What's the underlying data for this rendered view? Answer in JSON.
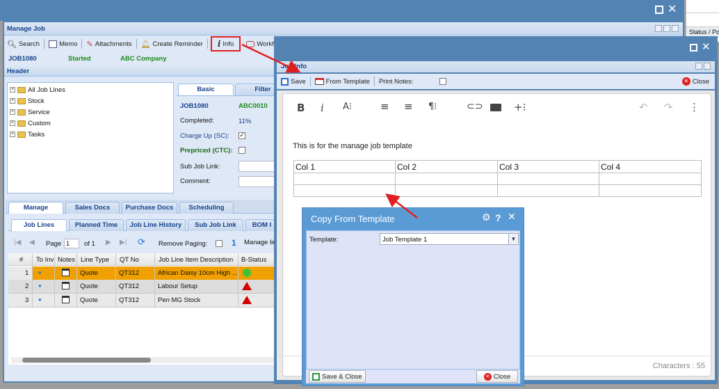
{
  "manage_job": {
    "title": "Manage Job",
    "toolbar": {
      "search": "Search",
      "memo": "Memo",
      "attachments": "Attachments",
      "create_reminder": "Create Reminder",
      "info": "Info",
      "workflow": "Workfl"
    },
    "job_no": "JOB1080",
    "status": "Started",
    "company": "ABC Company",
    "header_label": "Header",
    "status_po_col": "Status / Po",
    "tree": [
      "All Job Lines",
      "Stock",
      "Service",
      "Custom",
      "Tasks"
    ],
    "tabs_top": {
      "basic": "Basic",
      "filter": "Filter"
    },
    "basic": {
      "job": "JOB1080",
      "code": "ABC0010",
      "completed_label": "Completed:",
      "completed_value": "11%",
      "charge_up_label": "Charge Up (SC):",
      "prepriced_label": "Prepriced (CTC):",
      "subjob_label": "Sub Job Link:",
      "comment_label": "Comment:"
    },
    "tabs_main": [
      "Manage",
      "Sales Docs",
      "Purchase Docs",
      "Scheduling"
    ],
    "tabs_sub": [
      "Job Lines",
      "Planned Time",
      "Job Line History",
      "Sub Job Link",
      "BOM I"
    ],
    "pager": {
      "page_label": "Page",
      "page_value": "1",
      "of_label": "of 1",
      "remove_paging": "Remove Paging:",
      "num": "1",
      "manage": "Manage lin"
    },
    "columns": [
      "#",
      "To Inv",
      "Notes",
      "Line Type",
      "QT No",
      "Job Line Item Description",
      "B-Status"
    ],
    "rows": [
      {
        "num": "1",
        "type": "Quote",
        "qt": "QT312",
        "desc": "African Daisy 10cm High ...",
        "status": "green-circle"
      },
      {
        "num": "2",
        "type": "Quote",
        "qt": "QT312",
        "desc": "Labour Setup",
        "status": "red-triangle"
      },
      {
        "num": "3",
        "type": "Quote",
        "qt": "QT312",
        "desc": "Pen MG Stock",
        "status": "red-triangle"
      }
    ]
  },
  "job_info": {
    "title": "Job Info",
    "toolbar": {
      "save": "Save",
      "from_template": "From Template",
      "print_notes": "Print Notes:",
      "close": "Close"
    },
    "content_text": "This is for the manage job template",
    "table_headers": [
      "Col 1",
      "Col 2",
      "Col 3",
      "Col 4"
    ],
    "characters": "Characters : 55"
  },
  "copy_dialog": {
    "title": "Copy From Template",
    "template_label": "Template:",
    "template_value": "Job Template 1",
    "save_close": "Save & Close",
    "close": "Close"
  },
  "colors": {
    "accent": "#5383b3",
    "dialog_header": "#5b9bd5",
    "red_annotation": "#e02020",
    "row_selected": "#f0a000"
  }
}
